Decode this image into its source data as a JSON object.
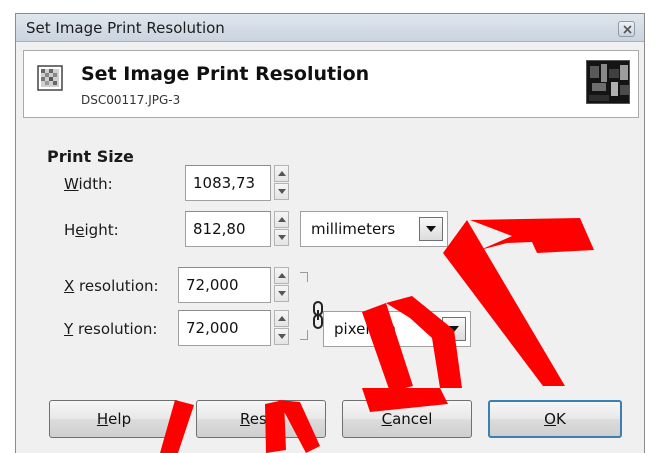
{
  "window": {
    "title": "Set Image Print Resolution",
    "close_icon": "close-icon"
  },
  "header": {
    "title": "Set Image Print Resolution",
    "subtitle": "DSC00117.JPG-3",
    "icon": "print-resolution-icon",
    "thumbnail": "image-thumbnail"
  },
  "print_size": {
    "section_title": "Print Size",
    "width_label": "Width:",
    "width_mnemonic": "W",
    "width_rest": "idth:",
    "width_value": "1083,73",
    "height_label": "Height:",
    "height_pre": "H",
    "height_mnemonic": "e",
    "height_rest": "ight:",
    "height_value": "812,80",
    "size_unit": "millimeters"
  },
  "resolution": {
    "x_label": "X resolution:",
    "x_mnemonic": "X",
    "x_rest": " resolution:",
    "x_value": "72,000",
    "y_label": "Y resolution:",
    "y_mnemonic": "Y",
    "y_rest": " resolution:",
    "y_value": "72,000",
    "unit": "pixels/in",
    "chain_icon": "chain-link-icon"
  },
  "buttons": {
    "help_mnemonic": "H",
    "help_rest": "elp",
    "reset_mnemonic": "R",
    "reset_rest": "eset",
    "cancel_mnemonic": "C",
    "cancel_rest": "ancel",
    "ok_mnemonic": "O",
    "ok_rest": "K"
  },
  "watermark": {
    "color": "#ff0000"
  }
}
